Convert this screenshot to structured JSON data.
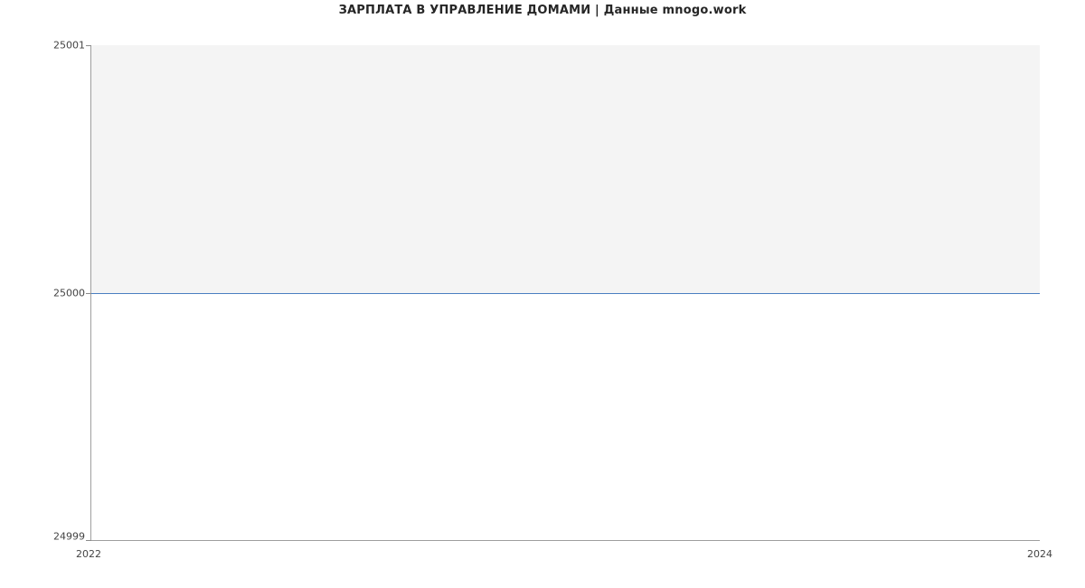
{
  "chart_data": {
    "type": "line",
    "title": "ЗАРПЛАТА В УПРАВЛЕНИЕ ДОМАМИ | Данные mnogo.work",
    "x": [
      2022,
      2024
    ],
    "values": [
      25000,
      25000
    ],
    "xlabel": "",
    "ylabel": "",
    "xlim": [
      2022,
      2024
    ],
    "ylim": [
      24999,
      25001
    ],
    "x_ticks": [
      "2022",
      "2024"
    ],
    "y_ticks": [
      "25001",
      "25000",
      "24999"
    ],
    "line_color": "#4a7fc1",
    "plot_bg": "#f4f4f4"
  }
}
